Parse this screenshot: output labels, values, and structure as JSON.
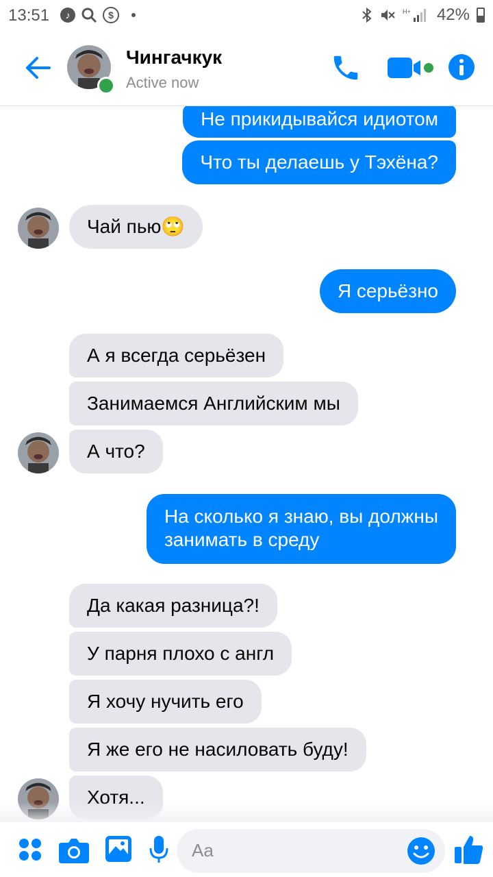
{
  "status_bar": {
    "time": "13:51",
    "battery": "42%",
    "battery_level": 0.42
  },
  "header": {
    "contact_name": "Чингачкук",
    "status": "Active now",
    "icons": [
      "back-arrow-icon",
      "phone-icon",
      "video-icon",
      "info-icon"
    ]
  },
  "messages": [
    {
      "from": "me",
      "text": "Не прикидывайся идиотом"
    },
    {
      "from": "me",
      "text": "Что ты делаешь у Тэхёна?"
    },
    {
      "from": "them",
      "text": "Чай пью🙄"
    },
    {
      "from": "me",
      "text": "Я серьёзно"
    },
    {
      "from": "them",
      "text": "А я всегда серьёзен"
    },
    {
      "from": "them",
      "text": "Занимаемся Английским мы"
    },
    {
      "from": "them",
      "text": "А что?"
    },
    {
      "from": "me",
      "line1": "На сколько я знаю, вы должны",
      "line2": "занимать в среду"
    },
    {
      "from": "them",
      "text": "Да какая разница?!"
    },
    {
      "from": "them",
      "text": "У парня плохо с англ"
    },
    {
      "from": "them",
      "text": "Я хочу нучить его"
    },
    {
      "from": "them",
      "text": "Я же его не насиловать буду!"
    },
    {
      "from": "them",
      "text": "Хотя..."
    }
  ],
  "composer": {
    "placeholder": "Aa",
    "icons": [
      "apps-icon",
      "camera-icon",
      "gallery-icon",
      "microphone-icon",
      "emoji-icon",
      "thumbs-up-icon"
    ]
  },
  "colors": {
    "accent": "#0084ff",
    "incoming_bubble": "#e4e6eb",
    "presence": "#31a24c"
  }
}
